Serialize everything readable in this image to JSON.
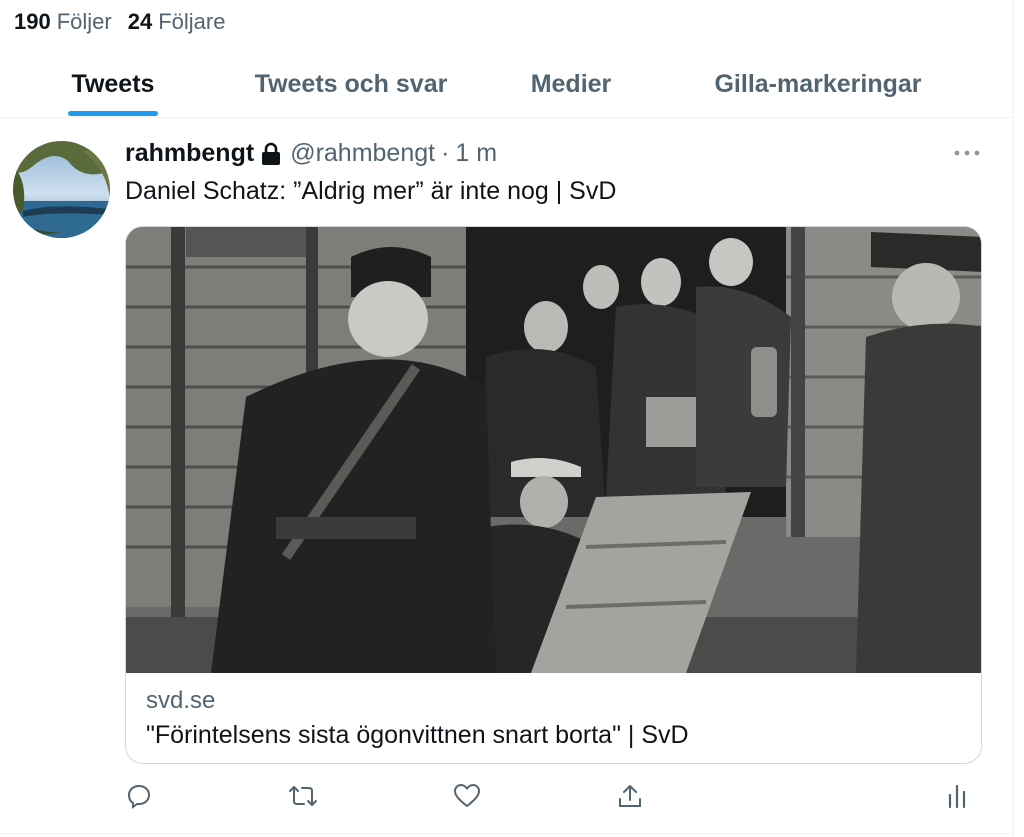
{
  "profile_stats": {
    "following_count": "190",
    "following_label": "Följer",
    "followers_count": "24",
    "followers_label": "Följare"
  },
  "tabs": [
    {
      "label": "Tweets",
      "active": true
    },
    {
      "label": "Tweets och svar",
      "active": false
    },
    {
      "label": "Medier",
      "active": false
    },
    {
      "label": "Gilla-markeringar",
      "active": false
    }
  ],
  "tweet": {
    "display_name": "rahmbengt",
    "handle": "@rahmbengt",
    "separator": "·",
    "time": "1 m",
    "text": "Daniel Schatz: ”Aldrig mer” är inte nog | SvD",
    "card": {
      "domain": "svd.se",
      "title": "\"Förintelsens sista ögonvittnen snart borta\" | SvD"
    },
    "icons": {
      "lock": "lock-icon",
      "more": "more-icon",
      "reply": "reply-icon",
      "retweet": "retweet-icon",
      "like": "heart-icon",
      "share": "share-icon",
      "analytics": "analytics-icon"
    }
  },
  "colors": {
    "accent": "#1d9bf0",
    "text_primary": "#0f1419",
    "text_secondary": "#536471",
    "border": "#cfd9de"
  }
}
